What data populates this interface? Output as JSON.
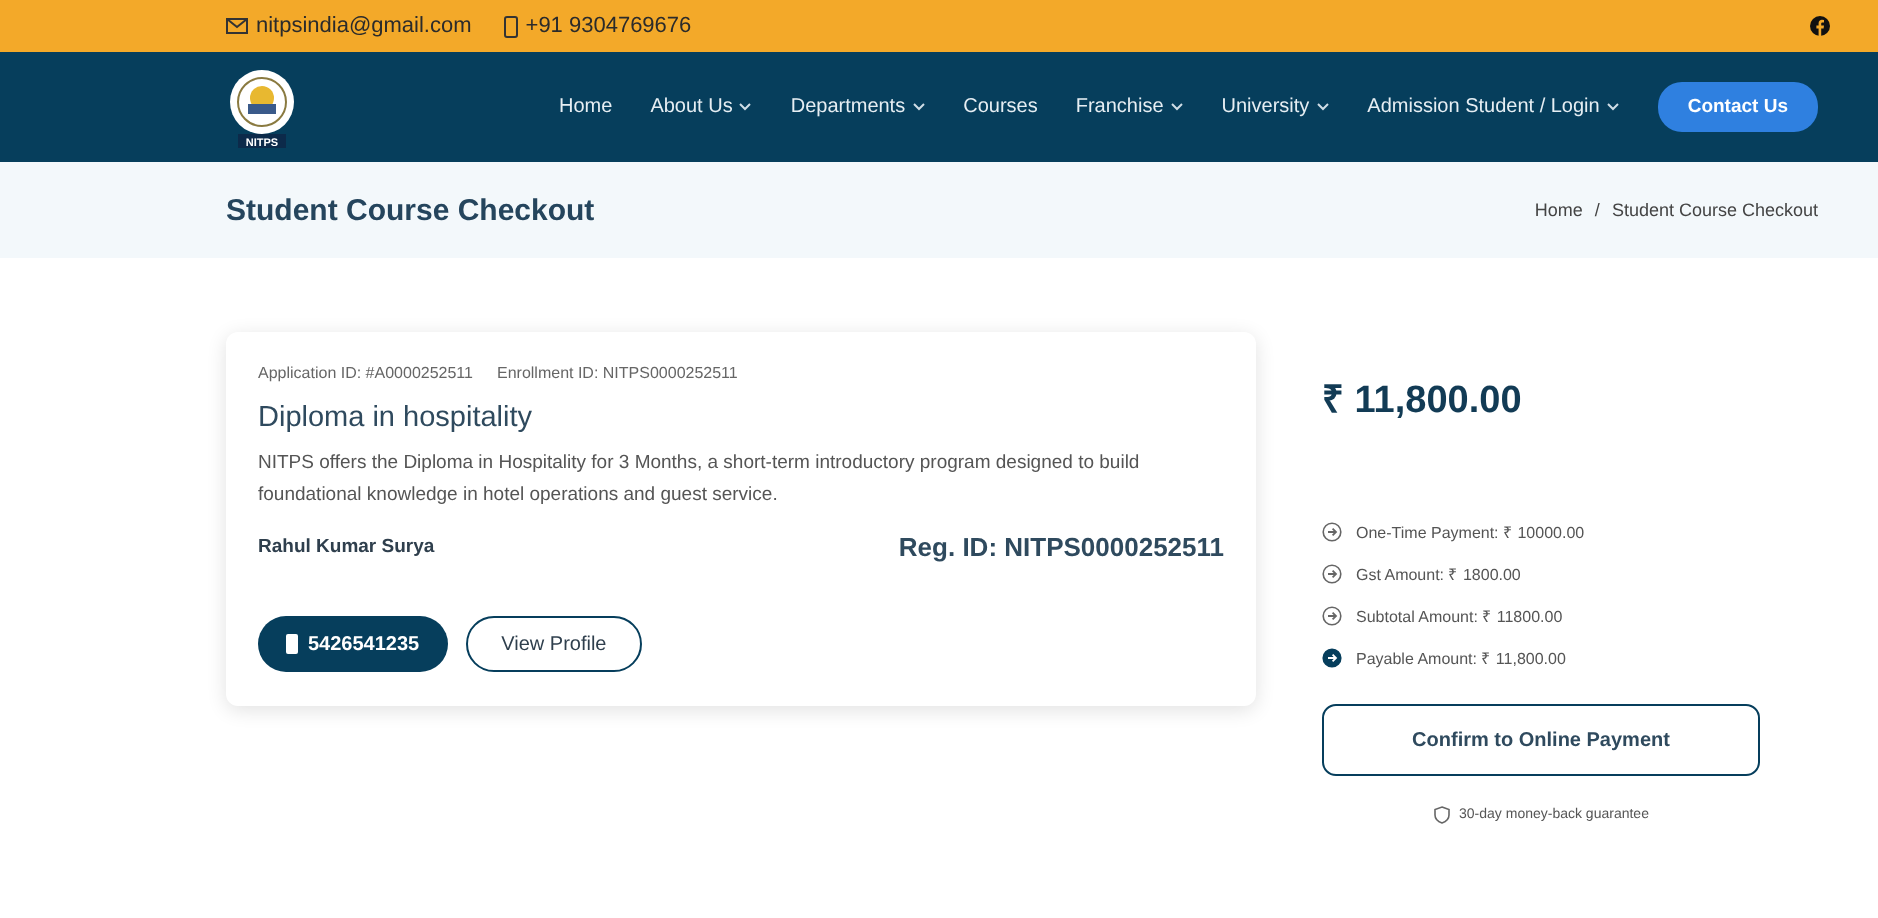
{
  "topbar": {
    "email": "nitpsindia@gmail.com",
    "phone": "+91 9304769676"
  },
  "nav": {
    "logo_text": "NITPS",
    "items": [
      {
        "label": "Home",
        "dropdown": false
      },
      {
        "label": "About Us",
        "dropdown": true
      },
      {
        "label": "Departments",
        "dropdown": true
      },
      {
        "label": "Courses",
        "dropdown": false
      },
      {
        "label": "Franchise",
        "dropdown": true
      },
      {
        "label": "University",
        "dropdown": true
      },
      {
        "label": "Admission Student / Login",
        "dropdown": true
      }
    ],
    "cta": "Contact Us"
  },
  "page_header": {
    "title": "Student Course Checkout",
    "breadcrumb": [
      "Home",
      "Student Course Checkout"
    ],
    "separator": "/"
  },
  "course_card": {
    "application_id": "Application ID: #A0000252511",
    "enrollment_id": "Enrollment ID: NITPS0000252511",
    "title": "Diploma in hospitality",
    "description": "NITPS offers the Diploma in Hospitality for 3 Months, a short-term introductory program designed to build foundational knowledge in hotel operations and guest service.",
    "student_name": "Rahul Kumar Surya",
    "reg_id": "Reg. ID: NITPS0000252511",
    "phone_button": "5426541235",
    "profile_button": "View Profile"
  },
  "summary": {
    "total": "₹ 11,800.00",
    "lines": [
      {
        "label": "One-Time Payment: ₹ 10000.00",
        "kind": "item"
      },
      {
        "label": "Gst Amount: ₹ 1800.00",
        "kind": "item"
      },
      {
        "label": "Subtotal Amount: ₹ 11800.00",
        "kind": "item"
      },
      {
        "label": "Payable Amount: ₹ 11,800.00",
        "kind": "total"
      }
    ],
    "confirm_button": "Confirm to Online Payment",
    "guarantee": "30-day money-back guarantee"
  }
}
